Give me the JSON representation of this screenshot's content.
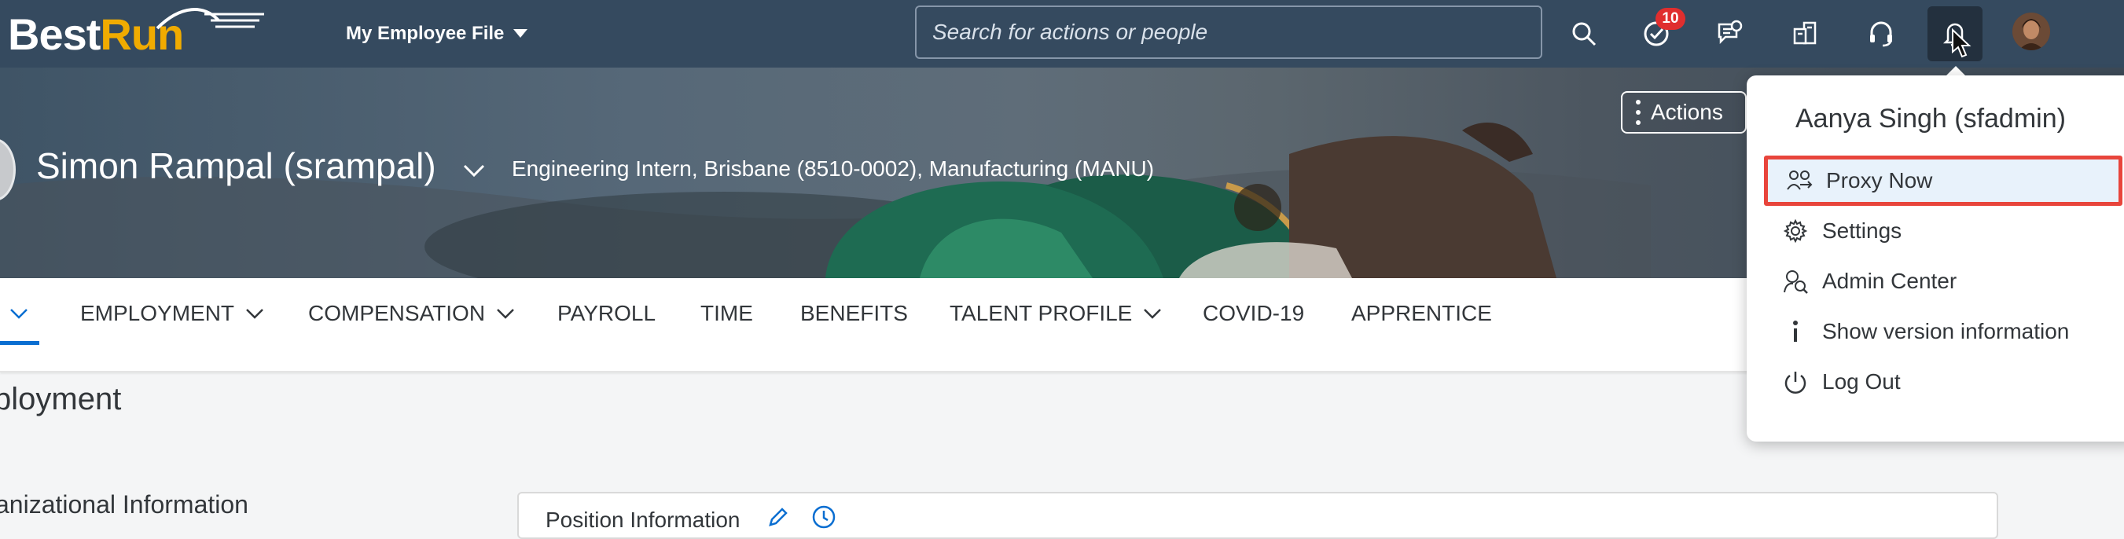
{
  "brand": {
    "best": "Best",
    "run": "Run"
  },
  "module_menu": {
    "label": "My Employee File"
  },
  "search": {
    "placeholder": "Search for actions or people"
  },
  "shell_icons": [
    {
      "name": "search-icon"
    },
    {
      "name": "todo-icon",
      "badge": "10"
    },
    {
      "name": "notifications-icon"
    },
    {
      "name": "org-chart-icon"
    },
    {
      "name": "help-icon"
    },
    {
      "name": "notification-bell-icon"
    }
  ],
  "employee": {
    "name": "Simon Rampal (srampal)",
    "title_line": "Engineering Intern, Brisbane (8510-0002), Manufacturing (MANU)"
  },
  "actions": {
    "label": "Actions"
  },
  "tabs": [
    {
      "label": "EMPLOYMENT",
      "has_menu": true
    },
    {
      "label": "COMPENSATION",
      "has_menu": true
    },
    {
      "label": "PAYROLL",
      "has_menu": false
    },
    {
      "label": "TIME",
      "has_menu": false
    },
    {
      "label": "BENEFITS",
      "has_menu": false
    },
    {
      "label": "TALENT PROFILE",
      "has_menu": true
    },
    {
      "label": "COVID-19",
      "has_menu": false
    },
    {
      "label": "APPRENTICE",
      "has_menu": false
    }
  ],
  "main": {
    "section_title": "ployment",
    "org_title": "anizational Information",
    "position_card": {
      "title": "Position Information"
    }
  },
  "user_menu": {
    "user": "Aanya Singh (sfadmin)",
    "items": [
      {
        "label": "Proxy Now",
        "icon": "proxy-icon",
        "highlighted": true
      },
      {
        "label": "Settings",
        "icon": "gear-icon"
      },
      {
        "label": "Admin Center",
        "icon": "admin-center-icon"
      },
      {
        "label": "Show version information",
        "icon": "info-icon"
      },
      {
        "label": "Log Out",
        "icon": "power-icon"
      }
    ]
  },
  "colors": {
    "shell": "#354a5f",
    "accent": "#0a6ed1",
    "highlight_border": "#e8453c",
    "badge": "#e02e2e",
    "brand_orange": "#f0ab00"
  }
}
